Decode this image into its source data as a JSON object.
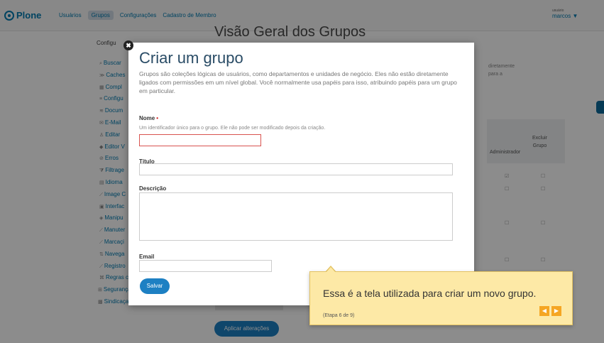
{
  "topbar": {
    "logo": "Plone",
    "nav": [
      "Usuários",
      "Grupos",
      "Configurações",
      "Cadastro de Membro"
    ],
    "active_nav": "Grupos",
    "user_caption": "usuário",
    "user_name": "marcos ▼"
  },
  "sidebar": {
    "title": "Configu",
    "items": [
      {
        "label": "Buscar",
        "icon": "search-icon"
      },
      {
        "label": "Caches",
        "icon": "cache-icon"
      },
      {
        "label": "Compl",
        "icon": "addon-icon"
      },
      {
        "label": "Configu",
        "icon": "list-icon"
      },
      {
        "label": "Docum",
        "icon": "document-icon"
      },
      {
        "label": "E-Mail",
        "icon": "mail-icon"
      },
      {
        "label": "Editar",
        "icon": "user-icon"
      },
      {
        "label": "Editor V",
        "icon": "editor-icon"
      },
      {
        "label": "Erros",
        "icon": "error-icon"
      },
      {
        "label": "Filtrage",
        "icon": "filter-icon"
      },
      {
        "label": "Idioma",
        "icon": "language-icon"
      },
      {
        "label": "Image C",
        "icon": "image-icon"
      },
      {
        "label": "Interfac",
        "icon": "interface-icon"
      },
      {
        "label": "Manipu",
        "icon": "manipulate-icon"
      },
      {
        "label": "Manuter",
        "icon": "maintenance-icon"
      },
      {
        "label": "Marcaçi",
        "icon": "markup-icon"
      },
      {
        "label": "Navega",
        "icon": "navigation-icon"
      },
      {
        "label": "Registro",
        "icon": "registry-icon"
      },
      {
        "label": "Regras c",
        "icon": "rules-icon"
      },
      {
        "label": "Segurança",
        "icon": "security-icon"
      },
      {
        "label": "Sindicaçação",
        "icon": "syndication-icon"
      }
    ]
  },
  "background": {
    "page_title": "Visão Geral dos Grupos",
    "description": "diretamente\npara a",
    "col_admin": "Administrador",
    "col_delete": "Excluir\nGrupo",
    "apply_button": "Aplicar alterações"
  },
  "modal": {
    "title": "Criar um grupo",
    "description": "Grupos são coleções lógicas de usuários, como departamentos e unidades de negócio. Eles não estão diretamente ligados com permissões em um nível global. Você normalmente usa papéis para isso, atribuindo papéis para um grupo em particular.",
    "name_label": "Nome",
    "name_required": "•",
    "name_help": "Um identificador único para o grupo. Ele não pode ser modificado depois da criação.",
    "name_value": "",
    "title_label": "Título",
    "title_value": "",
    "description_label": "Descrição",
    "description_value": "",
    "email_label": "Email",
    "email_value": "",
    "save_label": "Salvar",
    "close_symbol": "✖"
  },
  "tour": {
    "text": "Essa é a tela utilizada para criar um novo grupo.",
    "step": "(Etapa 6 de 9)",
    "prev_symbol": "◀",
    "next_symbol": "▶"
  },
  "colors": {
    "accent": "#1d80c3",
    "title": "#2a4c66",
    "tooltip_bg": "#fde9a6",
    "tooltip_nav": "#f5a623"
  }
}
